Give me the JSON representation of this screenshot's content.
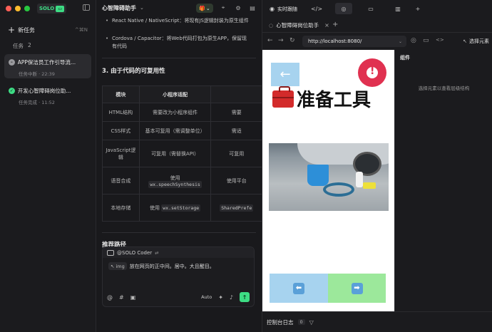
{
  "colors": {
    "accent": "#3ddc84",
    "traffic_red": "#ff5f57",
    "traffic_yellow": "#febc2e",
    "traffic_green": "#28c840",
    "alert_red": "#e03150",
    "btn_blue": "#a7d3ef",
    "btn_green": "#9ce89b"
  },
  "sidebar": {
    "brand": "SOLO",
    "new_task_label": "新任务",
    "new_task_shortcut": "^⌘N",
    "tasks_header": "任务",
    "tasks_count": "2",
    "tasks": [
      {
        "title": "APP保洁员工作引导流...",
        "status": "任务中断 · 22:39",
        "state": "interrupted"
      },
      {
        "title": "开发心智障碍岗位助...",
        "status": "任务完成 · 11:52",
        "state": "done"
      }
    ]
  },
  "doc": {
    "title": "心智障碍助手",
    "bullets": [
      "React Native / NativeScript：将现有JS逻辑封装为原生组件",
      "Cordova / Capacitor：将Web代码打包为原生APP，保留现有代码"
    ],
    "section_reuse": "3. 由于代码的可复用性",
    "section_reuse_display": "3. 由于代码的可复用性",
    "table": {
      "headers": [
        "模块",
        "小程序适配",
        ""
      ],
      "rows": [
        {
          "module": "HTML结构",
          "mini": "需要改为小程序组件",
          "third": "需要"
        },
        {
          "module": "CSS样式",
          "mini": "基本可复用（需调整单位）",
          "third": "需适"
        },
        {
          "module": "JavaScript逻辑",
          "mini": "可复用（需替换API）",
          "third": "可复用"
        },
        {
          "module": "语音合成",
          "mini_prefix": "使用",
          "mini_code": "wx.speechSynthesis",
          "third": "使用平台"
        },
        {
          "module": "本地存储",
          "mini_prefix": "使用",
          "mini_code": "wx.setStorage",
          "third_code": "SharedPrefe"
        }
      ]
    },
    "section_path": "推荐路径",
    "coder": {
      "name": "@SOLO Coder",
      "chip": "img",
      "text": "放在网页的正中间。居中。大且醒目。",
      "mode": "Auto"
    }
  },
  "browser": {
    "live_label": "实时跟随",
    "page_tab": "心智障碍岗位助手",
    "url": "http://localhost:8080/",
    "picker_label": "选择元素",
    "page": {
      "heading": "准备工具"
    },
    "components_label": "组件",
    "components_hint": "选择元素以查看层级结构",
    "console_label": "控制台日志",
    "console_count": "0"
  }
}
